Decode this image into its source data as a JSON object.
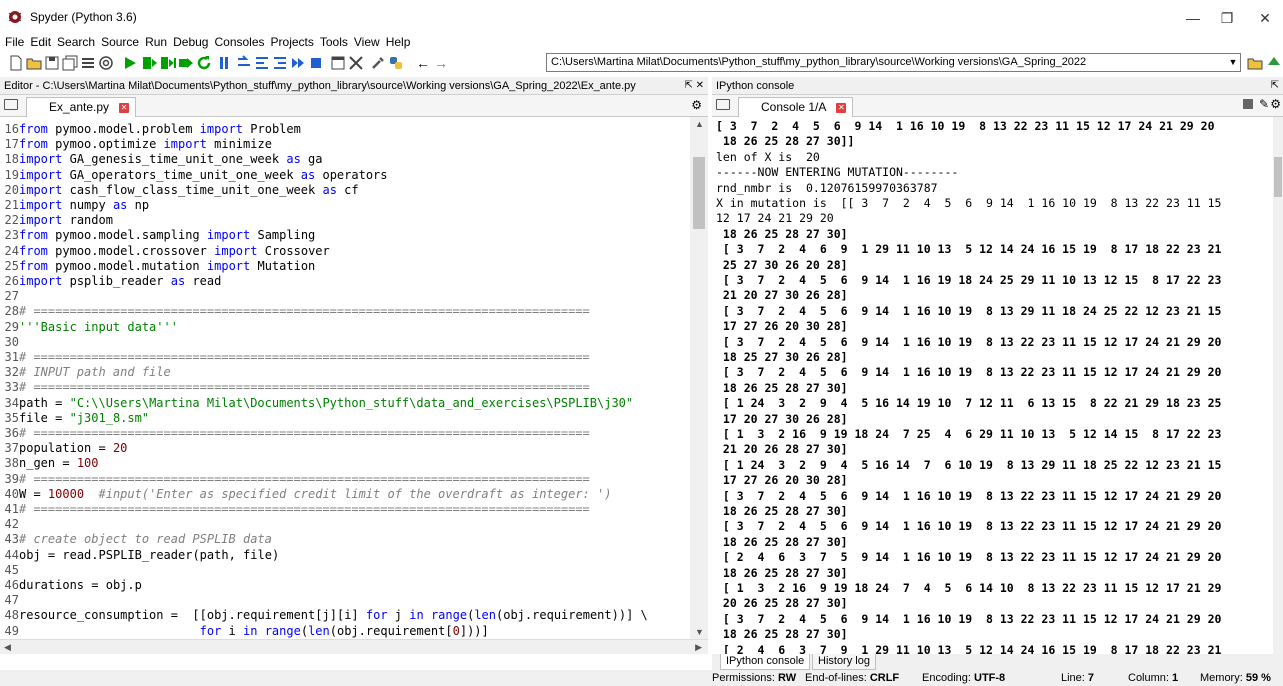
{
  "window": {
    "title": "Spyder (Python 3.6)"
  },
  "menu": [
    "File",
    "Edit",
    "Search",
    "Source",
    "Run",
    "Debug",
    "Consoles",
    "Projects",
    "Tools",
    "View",
    "Help"
  ],
  "toolbar": {
    "working_dir": "C:\\Users\\Martina Milat\\Documents\\Python_stuff\\my_python_library\\source\\Working versions\\GA_Spring_2022"
  },
  "editor": {
    "header": "Editor - C:\\Users\\Martina Milat\\Documents\\Python_stuff\\my_python_library\\source\\Working versions\\GA_Spring_2022\\Ex_ante.py",
    "tab": "Ex_ante.py",
    "lines": [
      {
        "n": "16",
        "t": "from pymoo.model.problem import Problem"
      },
      {
        "n": "17",
        "t": "from pymoo.optimize import minimize"
      },
      {
        "n": "18",
        "t": "import GA_genesis_time_unit_one_week as ga"
      },
      {
        "n": "19",
        "t": "import GA_operators_time_unit_one_week as operators"
      },
      {
        "n": "20",
        "t": "import cash_flow_class_time_unit_one_week as cf"
      },
      {
        "n": "21",
        "t": "import numpy as np"
      },
      {
        "n": "22",
        "t": "import random"
      },
      {
        "n": "23",
        "t": "from pymoo.model.sampling import Sampling"
      },
      {
        "n": "24",
        "t": "from pymoo.model.crossover import Crossover"
      },
      {
        "n": "25",
        "t": "from pymoo.model.mutation import Mutation"
      },
      {
        "n": "26",
        "t": "import psplib_reader as read"
      },
      {
        "n": "27",
        "t": ""
      },
      {
        "n": "28",
        "t": "# ============================================================================="
      },
      {
        "n": "29",
        "t": "'''Basic input data'''"
      },
      {
        "n": "30",
        "t": ""
      },
      {
        "n": "31",
        "t": "# ============================================================================="
      },
      {
        "n": "32",
        "t": "# INPUT path and file"
      },
      {
        "n": "33",
        "t": "# ============================================================================="
      },
      {
        "n": "34",
        "t": "path = \"C:\\\\Users\\Martina Milat\\Documents\\Python_stuff\\data_and_exercises\\PSPLIB\\j30\""
      },
      {
        "n": "35",
        "t": "file = \"j301_8.sm\""
      },
      {
        "n": "36",
        "t": "# ============================================================================="
      },
      {
        "n": "37",
        "t": "population = 20"
      },
      {
        "n": "38",
        "t": "n_gen = 100"
      },
      {
        "n": "39",
        "t": "# ============================================================================="
      },
      {
        "n": "40",
        "t": "W = 10000  #input('Enter as specified credit limit of the overdraft as integer: ')"
      },
      {
        "n": "41",
        "t": "# ============================================================================="
      },
      {
        "n": "42",
        "t": ""
      },
      {
        "n": "43",
        "t": "# create object to read PSPLIB data"
      },
      {
        "n": "44",
        "t": "obj = read.PSPLIB_reader(path, file)"
      },
      {
        "n": "45",
        "t": ""
      },
      {
        "n": "46",
        "t": "durations = obj.p"
      },
      {
        "n": "47",
        "t": ""
      },
      {
        "n": "48",
        "t": "resource_consumption =  [[obj.requirement[j][i] for j in range(len(obj.requirement))] \\"
      },
      {
        "n": "49",
        "t": "                         for i in range(len(obj.requirement[0]))]"
      },
      {
        "n": "50",
        "t": ""
      }
    ]
  },
  "console": {
    "header": "IPython console",
    "tab": "Console 1/A",
    "lines": [
      {
        "t": "[ 3  7  2  4  5  6  9 14  1 16 10 19  8 13 22 23 11 15 12 17 24 21 29 20",
        "b": true
      },
      {
        "t": " 18 26 25 28 27 30]]",
        "b": true
      },
      {
        "t": "len of X is  20",
        "b": false
      },
      {
        "t": "------NOW ENTERING MUTATION--------",
        "b": false
      },
      {
        "t": "rnd_nmbr is  0.12076159970363787",
        "b": false
      },
      {
        "t": "X in mutation is  [[ 3  7  2  4  5  6  9 14  1 16 10 19  8 13 22 23 11 15",
        "b": false
      },
      {
        "t": "12 17 24 21 29 20",
        "b": false
      },
      {
        "t": " 18 26 25 28 27 30]",
        "b": true
      },
      {
        "t": " [ 3  7  2  4  6  9  1 29 11 10 13  5 12 14 24 16 15 19  8 17 18 22 23 21",
        "b": true
      },
      {
        "t": " 25 27 30 26 20 28]",
        "b": true
      },
      {
        "t": " [ 3  7  2  4  5  6  9 14  1 16 19 18 24 25 29 11 10 13 12 15  8 17 22 23",
        "b": true
      },
      {
        "t": " 21 20 27 30 26 28]",
        "b": true
      },
      {
        "t": " [ 3  7  2  4  5  6  9 14  1 16 10 19  8 13 29 11 18 24 25 22 12 23 21 15",
        "b": true
      },
      {
        "t": " 17 27 26 20 30 28]",
        "b": true
      },
      {
        "t": " [ 3  7  2  4  5  6  9 14  1 16 10 19  8 13 22 23 11 15 12 17 24 21 29 20",
        "b": true
      },
      {
        "t": " 18 25 27 30 26 28]",
        "b": true
      },
      {
        "t": " [ 3  7  2  4  5  6  9 14  1 16 10 19  8 13 22 23 11 15 12 17 24 21 29 20",
        "b": true
      },
      {
        "t": " 18 26 25 28 27 30]",
        "b": true
      },
      {
        "t": " [ 1 24  3  2  9  4  5 16 14 19 10  7 12 11  6 13 15  8 22 21 29 18 23 25",
        "b": true
      },
      {
        "t": " 17 20 27 30 26 28]",
        "b": true
      },
      {
        "t": " [ 1  3  2 16  9 19 18 24  7 25  4  6 29 11 10 13  5 12 14 15  8 17 22 23",
        "b": true
      },
      {
        "t": " 21 20 26 28 27 30]",
        "b": true
      },
      {
        "t": " [ 1 24  3  2  9  4  5 16 14  7  6 10 19  8 13 29 11 18 25 22 12 23 21 15",
        "b": true
      },
      {
        "t": " 17 27 26 20 30 28]",
        "b": true
      },
      {
        "t": " [ 3  7  2  4  5  6  9 14  1 16 10 19  8 13 22 23 11 15 12 17 24 21 29 20",
        "b": true
      },
      {
        "t": " 18 26 25 28 27 30]",
        "b": true
      },
      {
        "t": " [ 3  7  2  4  5  6  9 14  1 16 10 19  8 13 22 23 11 15 12 17 24 21 29 20",
        "b": true
      },
      {
        "t": " 18 26 25 28 27 30]",
        "b": true
      },
      {
        "t": " [ 2  4  6  3  7  5  9 14  1 16 10 19  8 13 22 23 11 15 12 17 24 21 29 20",
        "b": true
      },
      {
        "t": " 18 26 25 28 27 30]",
        "b": true
      },
      {
        "t": " [ 1  3  2 16  9 19 18 24  7  4  5  6 14 10  8 13 22 23 11 15 12 17 21 29",
        "b": true
      },
      {
        "t": " 20 26 25 28 27 30]",
        "b": true
      },
      {
        "t": " [ 3  7  2  4  5  6  9 14  1 16 10 19  8 13 22 23 11 15 12 17 24 21 29 20",
        "b": true
      },
      {
        "t": " 18 26 25 28 27 30]",
        "b": true
      },
      {
        "t": " [ 2  4  6  3  7  9  1 29 11 10 13  5 12 14 24 16 15 19  8 17 18 22 23 21",
        "b": true
      }
    ],
    "bottom_tabs": [
      "IPython console",
      "History log"
    ]
  },
  "status": {
    "permissions_label": "Permissions:",
    "permissions": "RW",
    "eol_label": "End-of-lines:",
    "eol": "CRLF",
    "encoding_label": "Encoding:",
    "encoding": "UTF-8",
    "line_label": "Line:",
    "line": "7",
    "column_label": "Column:",
    "column": "1",
    "memory_label": "Memory:",
    "memory": "59 %"
  },
  "colors": {
    "keyword": "#0000ff",
    "string": "#008000",
    "comment": "#808080",
    "number": "#800000"
  }
}
